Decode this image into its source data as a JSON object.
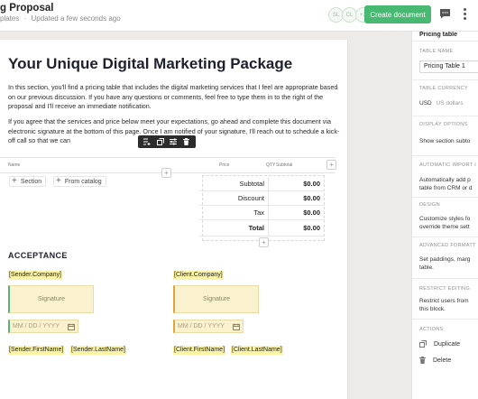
{
  "header": {
    "title": "g Proposal",
    "meta_left": "plates",
    "meta_sep": "·",
    "meta_status": "Updated a few seconds ago",
    "avatars": [
      "SL",
      "CL",
      "+2"
    ],
    "create_label": "Create document",
    "colors": {
      "create": "#47b972"
    }
  },
  "doc": {
    "heading": "Your Unique Digital Marketing Package",
    "p1": "In this section, you'll find a pricing table that includes the digital marketing services that I feel are appropriate based on our previous discussion. If you have any questions or comments, feel free to type them in to the right of the proposal and I'll receive an immediate notification.",
    "p2": "If you agree that the services and price below meet your expectations, go ahead and complete this document via electronic signature at the bottom of this page. Once I am notified of your signature, I'll reach out to schedule a kick-off call so that we can",
    "table_header": {
      "name": "Name",
      "price": "Price",
      "qty": "QTY",
      "subtotal": "Subtotal"
    },
    "add_section": "Section",
    "add_catalog": "From catalog",
    "summary": [
      {
        "label": "Subtotal",
        "value": "$0.00"
      },
      {
        "label": "Discount",
        "value": "$0.00"
      },
      {
        "label": "Tax",
        "value": "$0.00"
      }
    ],
    "total": {
      "label": "Total",
      "value": "$0.00"
    },
    "acceptance": "ACCEPTANCE",
    "sender": {
      "company": "[Sender.Company]",
      "signature": "Signature",
      "date_placeholder": "MM / DD / YYYY",
      "first": "[Sender.FirstName]",
      "last": "[Sender.LastName]"
    },
    "client": {
      "company": "[Client.Company]",
      "signature": "Signature",
      "date_placeholder": "MM / DD / YYYY",
      "first": "[Client.FirstName]",
      "last": "[Client.LastName]"
    }
  },
  "panel": {
    "title": "Pricing table",
    "table_name_label": "TABLE NAME",
    "table_name_value": "Pricing Table 1",
    "currency_label": "TABLE CURRENCY",
    "currency_code": "USD",
    "currency_name": "US dollars",
    "display_label": "DISPLAY OPTIONS",
    "display_text": "Show section subto",
    "import_label": "AUTOMATIC IMPORT I",
    "import_text_1": "Automatically add p",
    "import_text_2": "table from CRM or d",
    "design_label": "DESIGN",
    "design_text_1": "Customize styles fo",
    "design_text_2": "override theme sett",
    "advanced_label": "ADVANCED FORMATT",
    "advanced_text_1": "Set paddings, marg",
    "advanced_text_2": "table.",
    "restrict_label": "RESTRICT EDITING",
    "restrict_text_1": "Restrict users from",
    "restrict_text_2": "this block.",
    "actions_label": "ACTIONS",
    "duplicate": "Duplicate",
    "delete": "Delete"
  }
}
